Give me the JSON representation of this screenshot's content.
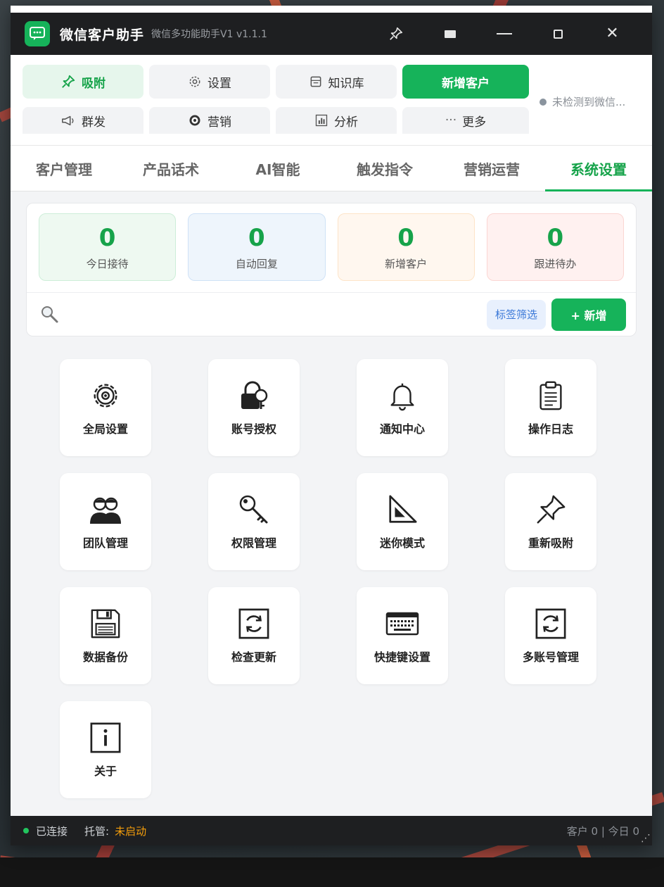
{
  "app": {
    "title": "微信客户助手",
    "subtitle": "微信多功能助手V1  v1.1.1"
  },
  "toolbar": {
    "row1": [
      {
        "label": "吸附",
        "icon": "pin-icon",
        "state": "active"
      },
      {
        "label": "设置",
        "icon": "gear-icon",
        "state": "normal"
      },
      {
        "label": "知识库",
        "icon": "book-icon",
        "state": "normal"
      },
      {
        "label": "新增客户",
        "icon": "",
        "state": "primary"
      }
    ],
    "row2": [
      {
        "label": "群发",
        "icon": "megaphone-icon"
      },
      {
        "label": "营销",
        "icon": "target-icon"
      },
      {
        "label": "分析",
        "icon": "bar-chart-icon"
      },
      {
        "label": "更多",
        "icon": "ellipsis-icon"
      }
    ],
    "wechat_status": "未检测到微信..."
  },
  "tabs": [
    "客户管理",
    "产品话术",
    "AI智能",
    "触发指令",
    "营销运营",
    "系统设置"
  ],
  "active_tab": "系统设置",
  "stats": [
    {
      "value": "0",
      "label": "今日接待"
    },
    {
      "value": "0",
      "label": "自动回复"
    },
    {
      "value": "0",
      "label": "新增客户"
    },
    {
      "value": "0",
      "label": "跟进待办"
    }
  ],
  "search": {
    "placeholder": ""
  },
  "filter_label": "标签筛选",
  "add_label": "+ 新增",
  "tiles": [
    {
      "label": "全局设置",
      "icon": "gear-icon"
    },
    {
      "label": "账号授权",
      "icon": "lock-key-icon"
    },
    {
      "label": "通知中心",
      "icon": "bell-icon"
    },
    {
      "label": "操作日志",
      "icon": "clipboard-icon"
    },
    {
      "label": "团队管理",
      "icon": "team-icon"
    },
    {
      "label": "权限管理",
      "icon": "key-icon"
    },
    {
      "label": "迷你模式",
      "icon": "triangle-ruler-icon"
    },
    {
      "label": "重新吸附",
      "icon": "pushpin-icon"
    },
    {
      "label": "数据备份",
      "icon": "floppy-disk-icon"
    },
    {
      "label": "检查更新",
      "icon": "refresh-icon"
    },
    {
      "label": "快捷键设置",
      "icon": "keyboard-icon"
    },
    {
      "label": "多账号管理",
      "icon": "refresh-icon"
    },
    {
      "label": "关于",
      "icon": "info-icon"
    }
  ],
  "statusbar": {
    "connection": "已连接",
    "hosting_label": "托管:",
    "hosting_value": "未启动",
    "right": "客户 0 | 今日 0"
  },
  "colors": {
    "brand": "#16b35a",
    "titlebar": "#1e1f21",
    "warning": "#f59e0b"
  }
}
